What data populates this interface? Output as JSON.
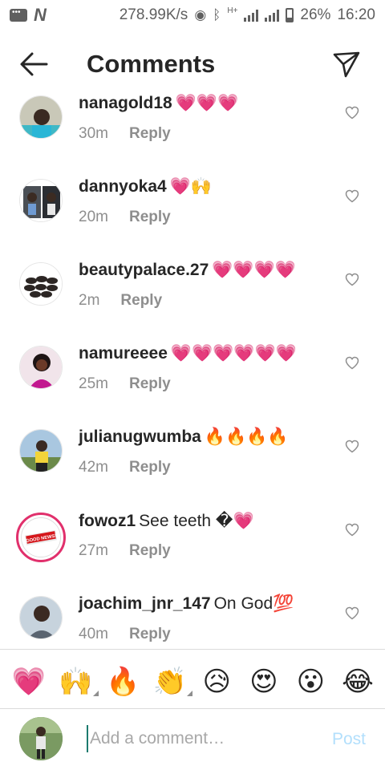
{
  "status_bar": {
    "speed": "278.99K/s",
    "network": "H+",
    "battery": "26%",
    "time": "16:20"
  },
  "header": {
    "title": "Comments"
  },
  "comments": [
    {
      "username": "nanagold18",
      "text": "💗💗💗",
      "time": "30m",
      "reply": "Reply"
    },
    {
      "username": "dannyoka4",
      "text": "💗🙌",
      "time": "20m",
      "reply": "Reply"
    },
    {
      "username": "beautypalace.27",
      "text": "💗💗💗💗",
      "time": "2m",
      "reply": "Reply"
    },
    {
      "username": "namureeee",
      "text": "💗💗💗💗💗💗",
      "time": "25m",
      "reply": "Reply"
    },
    {
      "username": "julianugwumba",
      "text": "🔥🔥🔥🔥",
      "time": "42m",
      "reply": "Reply"
    },
    {
      "username": "fowoz1",
      "text": "See teeth �💗",
      "time": "27m",
      "reply": "Reply",
      "avatar_text": "GOOD NEWS!"
    },
    {
      "username": "joachim_jnr_147",
      "text": "On God💯",
      "time": "40m",
      "reply": "Reply"
    }
  ],
  "emoji_bar": [
    "💗",
    "🙌",
    "🔥",
    "👏",
    "😥",
    "😍",
    "😮",
    "😂"
  ],
  "composer": {
    "placeholder": "Add a comment…",
    "post_label": "Post"
  },
  "colors": {
    "text": "#262626",
    "secondary": "#8e8e8e",
    "post_disabled": "#b2dffc",
    "story_ring": "#e1306c"
  }
}
